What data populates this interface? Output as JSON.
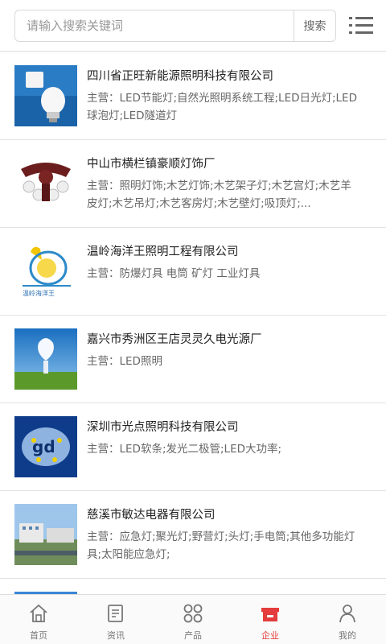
{
  "search": {
    "placeholder": "请输入搜索关键词",
    "button_label": "搜索"
  },
  "companies": [
    {
      "name": "四川省正旺新能源照明科技有限公司",
      "main_business": "主营：LED节能灯;自然光照明系统工程;LED日光灯;LED球泡灯;LED隧道灯"
    },
    {
      "name": "中山市横栏镇豪顺灯饰厂",
      "main_business": "主营：照明灯饰;木艺灯饰;木艺架子灯;木艺宫灯;木艺羊皮灯;木艺吊灯;木艺客房灯;木艺壁灯;吸顶灯;..."
    },
    {
      "name": "温岭海洋王照明工程有限公司",
      "main_business": "主营：防爆灯具 电筒 矿灯 工业灯具"
    },
    {
      "name": "嘉兴市秀洲区王店灵灵久电光源厂",
      "main_business": "主营：LED照明"
    },
    {
      "name": "深圳市光点照明科技有限公司",
      "main_business": "主营：LED软条;发光二极管;LED大功率;"
    },
    {
      "name": "慈溪市敏达电器有限公司",
      "main_business": "主营：应急灯;聚光灯;野营灯;头灯;手电筒;其他多功能灯具;太阳能应急灯;"
    }
  ],
  "tabbar": [
    {
      "label": "首页",
      "icon": "home-icon",
      "active": false
    },
    {
      "label": "资讯",
      "icon": "news-icon",
      "active": false
    },
    {
      "label": "产品",
      "icon": "grid-icon",
      "active": false
    },
    {
      "label": "企业",
      "icon": "store-icon",
      "active": true
    },
    {
      "label": "我的",
      "icon": "user-icon",
      "active": false
    }
  ],
  "colors": {
    "active": "#e43c3c",
    "inactive": "#777777",
    "accent_blue": "#1f6fb2"
  }
}
